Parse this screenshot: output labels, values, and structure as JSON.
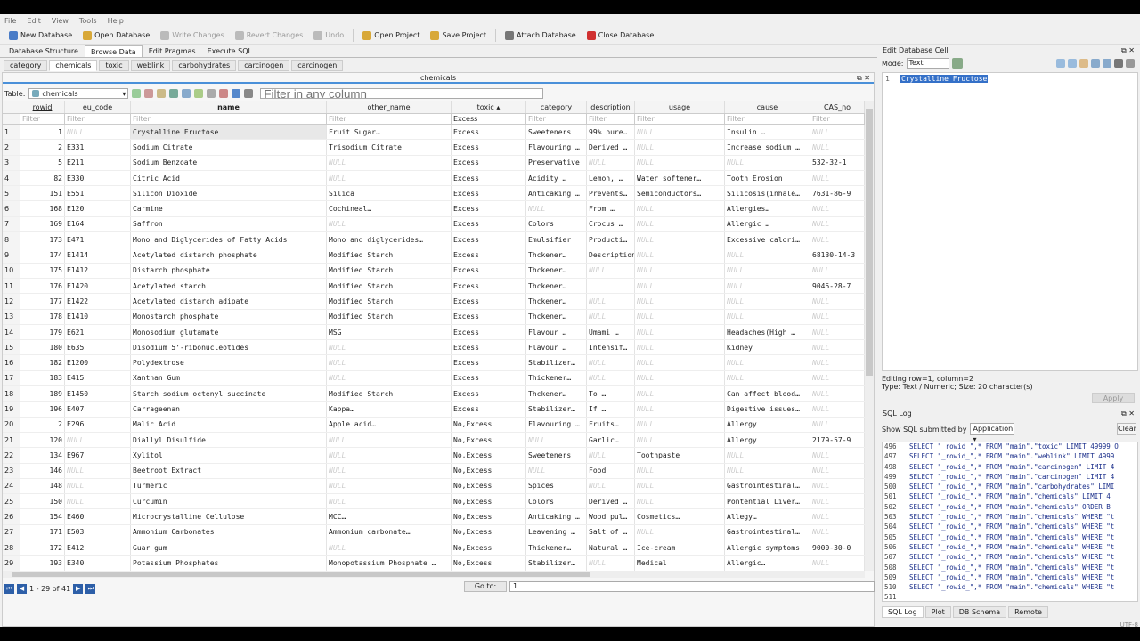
{
  "menu": [
    "File",
    "Edit",
    "View",
    "Tools",
    "Help"
  ],
  "toolbar": [
    {
      "label": "New Database",
      "icon": "new-db-icon",
      "color": "#4a7cc7",
      "enabled": true
    },
    {
      "label": "Open Database",
      "icon": "open-db-icon",
      "color": "#d8a838",
      "enabled": true
    },
    {
      "label": "Write Changes",
      "icon": "write-changes-icon",
      "color": "#bbbbbb",
      "enabled": false
    },
    {
      "label": "Revert Changes",
      "icon": "revert-changes-icon",
      "color": "#bbbbbb",
      "enabled": false
    },
    {
      "label": "Undo",
      "icon": "undo-icon",
      "color": "#bbbbbb",
      "enabled": false
    },
    {
      "label": "Open Project",
      "icon": "open-project-icon",
      "color": "#d8a838",
      "enabled": true
    },
    {
      "label": "Save Project",
      "icon": "save-project-icon",
      "color": "#d8a838",
      "enabled": true
    },
    {
      "label": "Attach Database",
      "icon": "attach-db-icon",
      "color": "#777777",
      "enabled": true
    },
    {
      "label": "Close Database",
      "icon": "close-db-icon",
      "color": "#d03030",
      "enabled": true
    }
  ],
  "main_tabs": [
    "Database Structure",
    "Browse Data",
    "Edit Pragmas",
    "Execute SQL"
  ],
  "table_tabs": [
    "category",
    "chemicals",
    "toxic",
    "weblink",
    "carbohydrates",
    "carcinogen",
    "carcinogen"
  ],
  "pane_title": "chemicals",
  "table_label": "Table:",
  "table_select": "chemicals",
  "filter_all_placeholder": "Filter in any column",
  "columns": [
    "rowid",
    "eu_code",
    "name",
    "other_name",
    "toxic ▴",
    "category",
    "description",
    "usage",
    "cause",
    "CAS_no"
  ],
  "filters": [
    "Filter",
    "Filter",
    "Filter",
    "Filter",
    "Excess",
    "Filter",
    "Filter",
    "Filter",
    "Filter",
    "Filter"
  ],
  "rows": [
    [
      "1",
      "NULL",
      "Crystalline Fructose",
      "Fruit Sugar…",
      "Excess",
      "Sweeteners",
      "99% pure…",
      "NULL",
      "Insulin …",
      "NULL"
    ],
    [
      "2",
      "E331",
      "Sodium Citrate",
      "Trisodium Citrate",
      "Excess",
      "Flavouring …",
      "Derived …",
      "NULL",
      "Increase sodium …",
      "NULL"
    ],
    [
      "5",
      "E211",
      "Sodium Benzoate",
      "NULL",
      "Excess",
      "Preservative",
      "NULL",
      "NULL",
      "NULL",
      "532-32-1"
    ],
    [
      "82",
      "E330",
      "Citric Acid",
      "NULL",
      "Excess",
      "Acidity …",
      "Lemon, …",
      "Water softener…",
      "Tooth Erosion",
      "NULL"
    ],
    [
      "151",
      "E551",
      "Silicon Dioxide",
      "Silica",
      "Excess",
      "Anticaking …",
      "Prevents…",
      "Semiconductors…",
      "Silicosis(inhale…",
      "7631-86-9"
    ],
    [
      "168",
      "E120",
      "Carmine",
      "Cochineal…",
      "Excess",
      "NULL",
      "From …",
      "NULL",
      "Allergies…",
      "NULL"
    ],
    [
      "169",
      "E164",
      "Saffron",
      "NULL",
      "Excess",
      "Colors",
      "Crocus …",
      "NULL",
      "Allergic …",
      "NULL"
    ],
    [
      "173",
      "E471",
      "Mono and Diglycerides of Fatty Acids",
      "Mono and diglycerides…",
      "Excess",
      "Emulsifier",
      "Producti…",
      "NULL",
      "Excessive calori…",
      "NULL"
    ],
    [
      "174",
      "E1414",
      "Acetylated distarch phosphate",
      "Modified Starch",
      "Excess",
      "Thckener…",
      "Description from foo…",
      "NULL",
      "NULL",
      "68130-14-3"
    ],
    [
      "175",
      "E1412",
      "Distarch phosphate",
      "Modified Starch",
      "Excess",
      "Thckener…",
      "NULL",
      "NULL",
      "NULL",
      "NULL"
    ],
    [
      "176",
      "E1420",
      "Acetylated starch",
      "Modified Starch",
      "Excess",
      "Thckener…",
      "",
      "NULL",
      "NULL",
      "9045-28-7"
    ],
    [
      "177",
      "E1422",
      "Acetylated distarch adipate",
      "Modified Starch",
      "Excess",
      "Thckener…",
      "NULL",
      "NULL",
      "NULL",
      "NULL"
    ],
    [
      "178",
      "E1410",
      "Monostarch phosphate",
      "Modified Starch",
      "Excess",
      "Thckener…",
      "NULL",
      "NULL",
      "NULL",
      "NULL"
    ],
    [
      "179",
      "E621",
      "Monosodium glutamate",
      "MSG",
      "Excess",
      "Flavour …",
      "Umami …",
      "NULL",
      "Headaches(High …",
      "NULL"
    ],
    [
      "180",
      "E635",
      "Disodium 5’-ribonucleotides",
      "NULL",
      "Excess",
      "Flavour …",
      "Intensif…",
      "NULL",
      "Kidney",
      "NULL"
    ],
    [
      "182",
      "E1200",
      "Polydextrose",
      "NULL",
      "Excess",
      "Stabilizer…",
      "NULL",
      "NULL",
      "NULL",
      "NULL"
    ],
    [
      "183",
      "E415",
      "Xanthan Gum",
      "NULL",
      "Excess",
      "Thickener…",
      "NULL",
      "NULL",
      "NULL",
      "NULL"
    ],
    [
      "189",
      "E1450",
      "Starch sodium octenyl succinate",
      "Modified Starch",
      "Excess",
      "Thckener…",
      "To …",
      "NULL",
      "Can affect blood…",
      "NULL"
    ],
    [
      "196",
      "E407",
      "Carrageenan",
      "Kappa…",
      "Excess",
      "Stabilizer…",
      "If …",
      "NULL",
      "Digestive issues…",
      "NULL"
    ],
    [
      "2",
      "E296",
      "Malic Acid",
      "Apple acid…",
      "No,Excess",
      "Flavouring …",
      "Fruits…",
      "NULL",
      "Allergy",
      "NULL"
    ],
    [
      "120",
      "NULL",
      "Diallyl Disulfide",
      "NULL",
      "No,Excess",
      "NULL",
      "Garlic…",
      "NULL",
      "Allergy",
      "2179-57-9"
    ],
    [
      "134",
      "E967",
      "Xylitol",
      "NULL",
      "No,Excess",
      "Sweeteners",
      "NULL",
      "Toothpaste",
      "NULL",
      "NULL"
    ],
    [
      "146",
      "NULL",
      "Beetroot Extract",
      "NULL",
      "No,Excess",
      "NULL",
      "Food",
      "NULL",
      "NULL",
      "NULL"
    ],
    [
      "148",
      "NULL",
      "Turmeric",
      "NULL",
      "No,Excess",
      "Spices",
      "NULL",
      "NULL",
      "Gastrointestinal…",
      "NULL"
    ],
    [
      "150",
      "NULL",
      "Curcumin",
      "NULL",
      "No,Excess",
      "Colors",
      "Derived …",
      "NULL",
      "Pontential Liver…",
      "NULL"
    ],
    [
      "154",
      "E460",
      "Microcrystalline Cellulose",
      "MCC…",
      "No,Excess",
      "Anticaking …",
      "Wood pul…",
      "Cosmetics…",
      "Allegy…",
      "NULL"
    ],
    [
      "171",
      "E503",
      "Ammonium Carbonates",
      "Ammonium carbonate…",
      "No,Excess",
      "Leavening …",
      "Salt of …",
      "NULL",
      "Gastrointestinal…",
      "NULL"
    ],
    [
      "172",
      "E412",
      "Guar gum",
      "NULL",
      "No,Excess",
      "Thickener…",
      "Natural …",
      "Ice-cream",
      "Allergic symptoms",
      "9000-30-0"
    ],
    [
      "193",
      "E340",
      "Potassium Phosphates",
      "Monopotassium Phosphate …",
      "No,Excess",
      "Stabilizer…",
      "NULL",
      "Medical",
      "Allergic…",
      "NULL"
    ]
  ],
  "pager": "1 - 29 of 41",
  "goto_label": "Go to:",
  "goto_value": "1",
  "edit_cell": {
    "title": "Edit Database Cell",
    "mode_label": "Mode:",
    "mode": "Text",
    "line": "1",
    "value": "Crystalline Fructose",
    "info1": "Editing row=1, column=2",
    "info2": "Type: Text / Numeric; Size: 20 character(s)",
    "apply": "Apply"
  },
  "sql_log": {
    "title": "SQL Log",
    "show_label": "Show SQL submitted by",
    "submitter": "Application",
    "clear": "Clear",
    "lines": [
      [
        "496",
        "SELECT \"_rowid_\",* FROM \"main\".\"toxic\" LIMIT 49999 O"
      ],
      [
        "497",
        "SELECT \"_rowid_\",* FROM \"main\".\"weblink\" LIMIT 4999"
      ],
      [
        "498",
        "SELECT \"_rowid_\",* FROM \"main\".\"carcinogen\" LIMIT 4"
      ],
      [
        "499",
        "SELECT \"_rowid_\",* FROM \"main\".\"carcinogen\" LIMIT 4"
      ],
      [
        "500",
        "SELECT \"_rowid_\",* FROM \"main\".\"carbohydrates\" LIMI"
      ],
      [
        "501",
        "SELECT \"_rowid_\",* FROM \"main\".\"chemicals\" LIMIT 4"
      ],
      [
        "502",
        "SELECT \"_rowid_\",* FROM \"main\".\"chemicals\"  ORDER B"
      ],
      [
        "503",
        "SELECT \"_rowid_\",* FROM \"main\".\"chemicals\" WHERE \"t"
      ],
      [
        "504",
        "SELECT \"_rowid_\",* FROM \"main\".\"chemicals\" WHERE \"t"
      ],
      [
        "505",
        "SELECT \"_rowid_\",* FROM \"main\".\"chemicals\" WHERE \"t"
      ],
      [
        "506",
        "SELECT \"_rowid_\",* FROM \"main\".\"chemicals\" WHERE \"t"
      ],
      [
        "507",
        "SELECT \"_rowid_\",* FROM \"main\".\"chemicals\" WHERE \"t"
      ],
      [
        "508",
        "SELECT \"_rowid_\",* FROM \"main\".\"chemicals\" WHERE \"t"
      ],
      [
        "509",
        "SELECT \"_rowid_\",* FROM \"main\".\"chemicals\" WHERE \"t"
      ],
      [
        "510",
        "SELECT \"_rowid_\",* FROM \"main\".\"chemicals\" WHERE \"t"
      ],
      [
        "511",
        ""
      ]
    ]
  },
  "right_tabs": [
    "SQL Log",
    "Plot",
    "DB Schema",
    "Remote"
  ],
  "encoding": "UTF-8"
}
